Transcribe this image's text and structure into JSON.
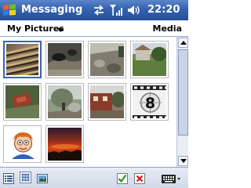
{
  "titlebar": {
    "app_title": "Messaging",
    "time": "22:20",
    "icons": [
      "windows-logo",
      "sync-icon",
      "signal-icon",
      "speaker-icon"
    ]
  },
  "header": {
    "folder": "My Pictures",
    "media": "Media"
  },
  "grid": {
    "thumbnails": [
      {
        "name": "wooden-stairs",
        "selected": true
      },
      {
        "name": "dark-cats-ground",
        "selected": false
      },
      {
        "name": "garden-rocks",
        "selected": false
      },
      {
        "name": "house-garden",
        "selected": false
      },
      {
        "name": "red-object-grass",
        "selected": false
      },
      {
        "name": "tree-path",
        "selected": false
      },
      {
        "name": "red-building",
        "selected": false
      },
      {
        "name": "film-countdown-8",
        "selected": false
      },
      {
        "name": "cartoon-boy",
        "selected": false
      },
      {
        "name": "sunset-sky",
        "selected": false
      }
    ],
    "countdown_digit": "8"
  },
  "toolbar": {
    "buttons": [
      "list-view",
      "thumbnail-view",
      "camera",
      "ok",
      "cancel",
      "keyboard"
    ]
  },
  "colors": {
    "titlebar": "#3462ad",
    "selection": "#3a63b8"
  }
}
